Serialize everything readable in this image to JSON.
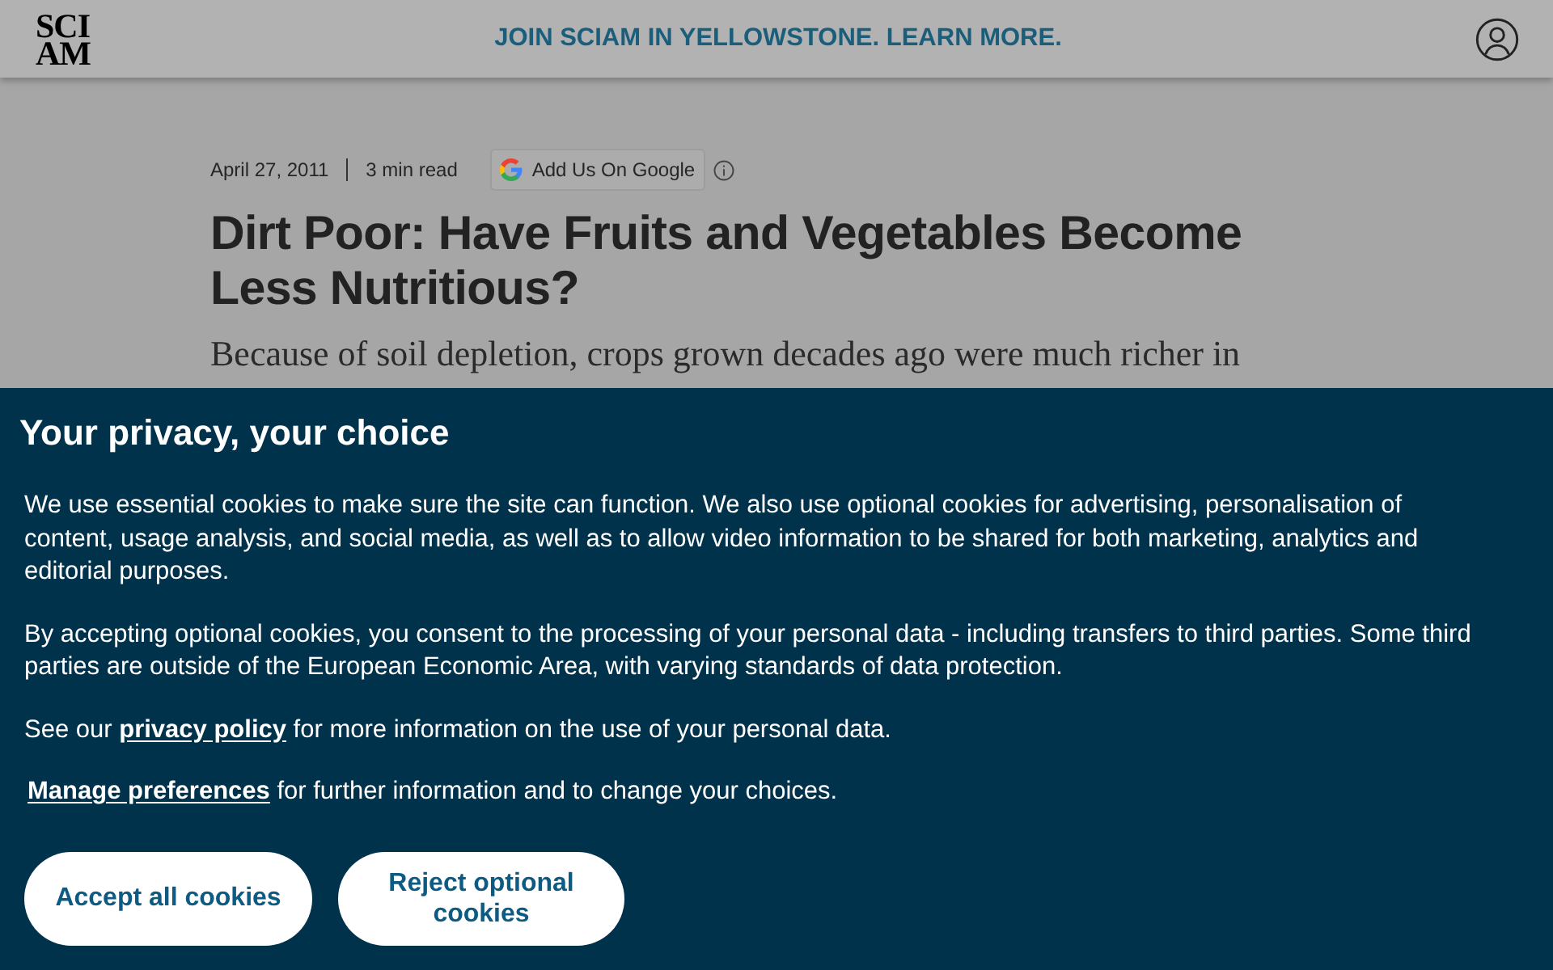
{
  "header": {
    "logo": "SCI AM",
    "promo": "JOIN SCIAM IN YELLOWSTONE. LEARN MORE."
  },
  "article": {
    "date": "April 27, 2011",
    "read_time": "3 min read",
    "google_button": "Add Us On Google",
    "title": "Dirt Poor: Have Fruits and Vegetables Become Less Nutritious?",
    "subtitle": "Because of soil depletion, crops grown decades ago were much richer in"
  },
  "cookie_banner": {
    "title": "Your privacy, your choice",
    "paragraphs": [
      {
        "parts": [
          {
            "kind": "text",
            "text": "We use essential cookies to make sure the site can function. We also use optional cookies for advertising, personalisation of content, usage analysis, and social media, as well as to allow video information to be shared for both marketing, analytics and editorial purposes."
          }
        ]
      },
      {
        "parts": [
          {
            "kind": "text",
            "text": "By accepting optional cookies, you consent to the processing of your personal data - including transfers to third parties. Some third parties are outside of the European Economic Area, with varying standards of data protection."
          }
        ]
      },
      {
        "parts": [
          {
            "kind": "text",
            "text": "See our "
          },
          {
            "kind": "link",
            "text": "privacy policy"
          },
          {
            "kind": "text",
            "text": " for more information on the use of your personal data."
          }
        ]
      },
      {
        "parts": [
          {
            "kind": "button_link",
            "text": "Manage preferences"
          },
          {
            "kind": "text",
            "text": " for further information and to change your choices."
          }
        ]
      }
    ],
    "buttons": [
      "Accept all cookies",
      "Reject optional cookies"
    ]
  }
}
